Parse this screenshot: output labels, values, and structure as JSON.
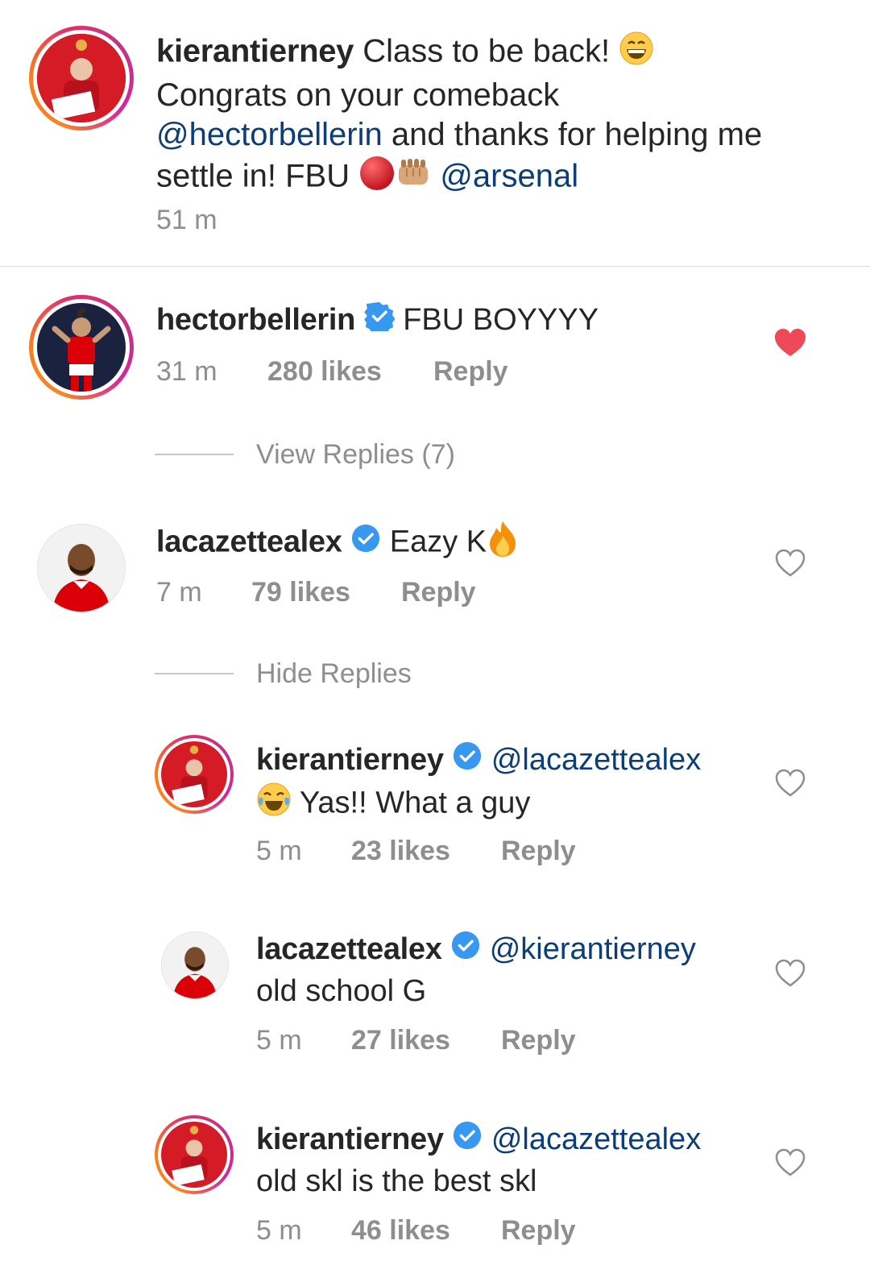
{
  "caption": {
    "username": "kierantierney",
    "line1": "Class to be back!",
    "line2": "Congrats on your comeback",
    "mention_hector": "@hectorbellerin",
    "line3_rest": "and thanks for helping me",
    "line4_start": "settle in! FBU",
    "mention_arsenal": "@arsenal",
    "time": "51 m"
  },
  "comments": [
    {
      "username": "hectorbellerin",
      "text": "FBU BOYYYY",
      "time": "31 m",
      "likes": "280 likes",
      "reply": "Reply",
      "liked": true,
      "replies_toggle": "View Replies (7)"
    },
    {
      "username": "lacazettealex",
      "text": "Eazy K",
      "time": "7 m",
      "likes": "79 likes",
      "reply": "Reply",
      "liked": false,
      "replies_toggle": "Hide Replies"
    }
  ],
  "replies": [
    {
      "username": "kierantierney",
      "mention": "@lacazettealex",
      "text": "Yas!! What a guy",
      "time": "5 m",
      "likes": "23 likes",
      "reply": "Reply"
    },
    {
      "username": "lacazettealex",
      "mention": "@kierantierney",
      "text": "old school G",
      "time": "5 m",
      "likes": "27 likes",
      "reply": "Reply"
    },
    {
      "username": "kierantierney",
      "mention": "@lacazettealex",
      "text": "old skl is the best skl",
      "time": "5 m",
      "likes": "46 likes",
      "reply": "Reply"
    }
  ],
  "colors": {
    "liked_heart": "#ed4956",
    "verified": "#3897f0",
    "mention": "#0b3d78",
    "meta": "#8e8e8e"
  }
}
